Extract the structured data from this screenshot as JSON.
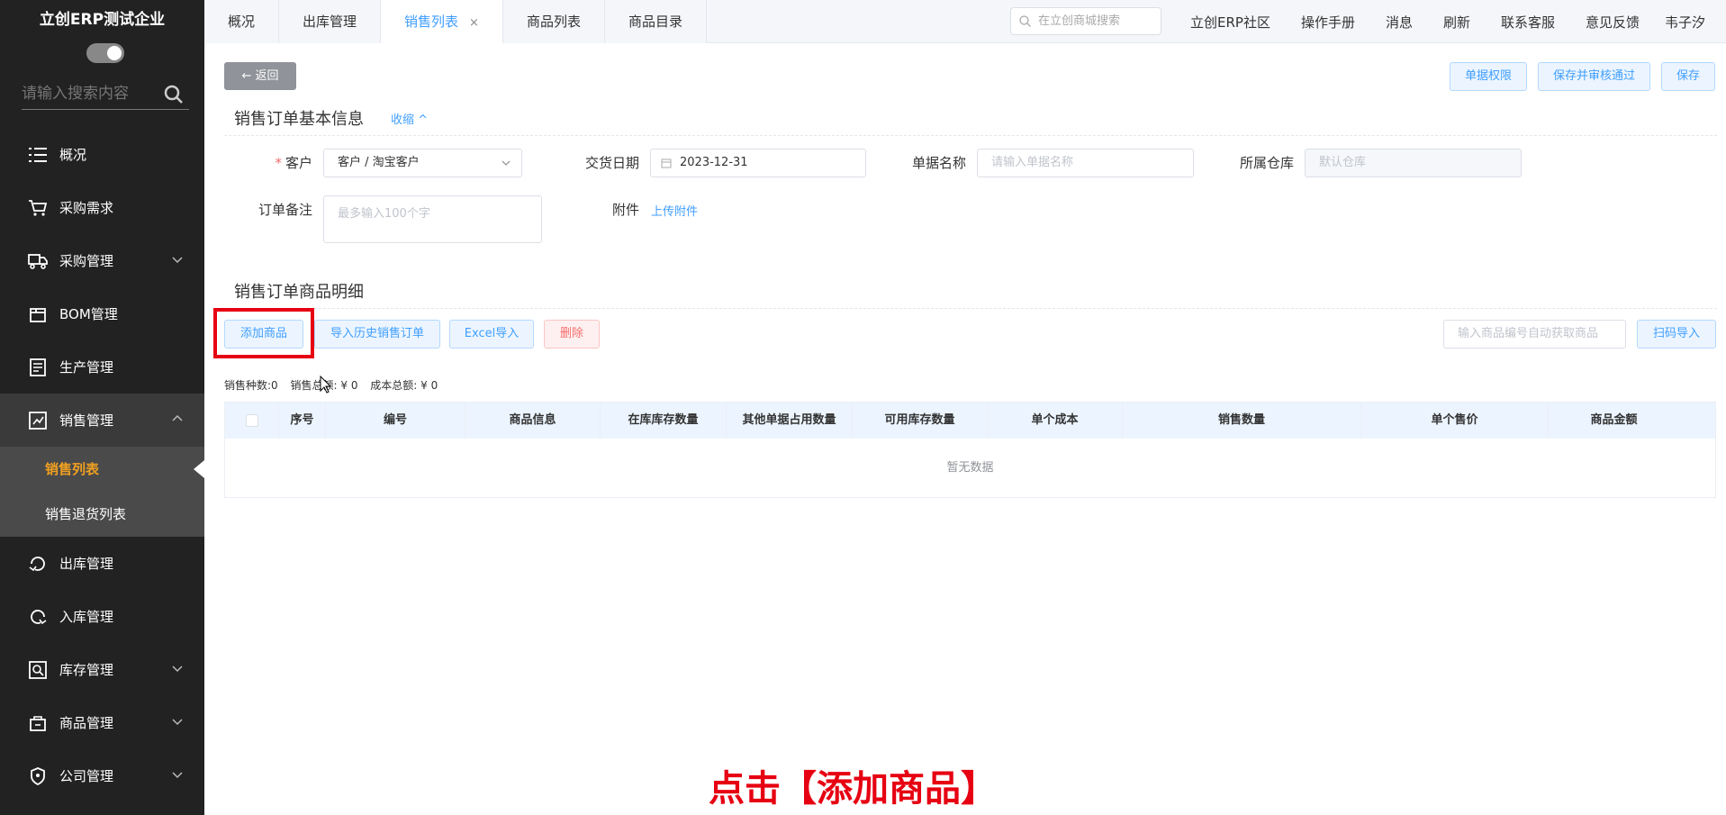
{
  "sidebar": {
    "brand": "立创ERP测试企业",
    "search_placeholder": "请输入搜索内容",
    "menu": [
      {
        "label": "概况",
        "icon": "list-icon"
      },
      {
        "label": "采购需求",
        "icon": "cart-icon"
      },
      {
        "label": "采购管理",
        "icon": "truck-icon",
        "chevron": "down"
      },
      {
        "label": "BOM管理",
        "icon": "box-icon"
      },
      {
        "label": "生产管理",
        "icon": "production-icon"
      },
      {
        "label": "销售管理",
        "icon": "sales-icon",
        "chevron": "up",
        "open": true
      }
    ],
    "submenu": [
      {
        "label": "销售列表",
        "active": true
      },
      {
        "label": "销售退货列表",
        "active": false
      }
    ],
    "menu_after": [
      {
        "label": "出库管理",
        "icon": "outbound-icon"
      },
      {
        "label": "入库管理",
        "icon": "inbound-icon"
      },
      {
        "label": "库存管理",
        "icon": "inventory-icon",
        "chevron": "down"
      },
      {
        "label": "商品管理",
        "icon": "goods-icon",
        "chevron": "down"
      },
      {
        "label": "公司管理",
        "icon": "company-icon",
        "chevron": "down"
      }
    ]
  },
  "topbar": {
    "tabs": [
      {
        "label": "概况",
        "active": false
      },
      {
        "label": "出库管理",
        "active": false
      },
      {
        "label": "销售列表",
        "active": true,
        "close": "×"
      },
      {
        "label": "商品列表",
        "active": false
      },
      {
        "label": "商品目录",
        "active": false
      }
    ],
    "search_placeholder": "在立创商城搜索",
    "links": [
      "立创ERP社区",
      "操作手册",
      "消息",
      "刷新",
      "联系客服",
      "意见反馈",
      "韦子汐"
    ]
  },
  "page": {
    "back_label": "← 返回",
    "actions": [
      "单据权限",
      "保存并审核通过",
      "保存"
    ],
    "basic_title": "销售订单基本信息",
    "collapse_label": "收缩 ^",
    "form": {
      "customer_label": "客户",
      "customer_required": "*",
      "customer_value": "客户 / 淘宝客户",
      "date_label": "交货日期",
      "date_value": "2023-12-31",
      "doc_name_label": "单据名称",
      "doc_name_placeholder": "请输入单据名称",
      "warehouse_label": "所属仓库",
      "warehouse_placeholder": "默认仓库",
      "remark_label": "订单备注",
      "remark_placeholder": "最多输入100个字",
      "attachment_label": "附件",
      "attachment_link": "上传附件"
    },
    "detail_title": "销售订单商品明细",
    "detail_buttons": [
      "添加商品",
      "导入历史销售订单",
      "Excel导入",
      "删除"
    ],
    "code_input_placeholder": "输入商品编号自动获取商品",
    "scan_button": "扫码导入",
    "stats": [
      "销售种数:0",
      "销售总额: ¥ 0",
      "成本总额: ¥ 0"
    ],
    "table": {
      "columns": [
        "",
        "序号",
        "编号",
        "商品信息",
        "在库库存数量",
        "其他单据占用数量",
        "可用库存数量",
        "单个成本",
        "销售数量",
        "单个售价",
        "商品金额"
      ],
      "empty_text": "暂无数据"
    },
    "caption": "点击【添加商品】"
  },
  "colors": {
    "sidebar_bg": "#222222",
    "accent": "#409eff",
    "active_menu": "#f0a020",
    "highlight_red": "#e60012"
  }
}
